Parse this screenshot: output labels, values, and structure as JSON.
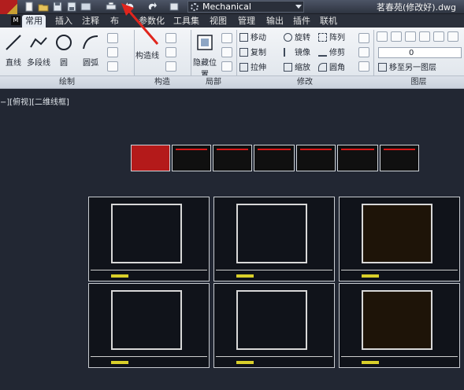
{
  "app": {
    "logo_letter": "M",
    "workspace": "Mechanical",
    "document_title": "茗春苑(修改好).dwg"
  },
  "tabs": [
    "常用",
    "插入",
    "注释",
    "布",
    "参数化",
    "工具集",
    "视图",
    "管理",
    "输出",
    "插件",
    "联机"
  ],
  "active_tab": "常用",
  "ribbon": {
    "draw": {
      "line": "直线",
      "polyline": "多段线",
      "circle": "圆",
      "arc": "圆弧",
      "footer": "绘制"
    },
    "construct": {
      "construction_line": "构造线",
      "footer": "构造"
    },
    "detail": {
      "hide": "隐藏位置",
      "footer": "局部"
    },
    "modify": {
      "move": "移动",
      "rotate": "旋转",
      "array": "阵列",
      "copy": "复制",
      "mirror": "镜像",
      "trim": "修剪",
      "stretch": "拉伸",
      "scale": "缩放",
      "fillet": "圆角",
      "footer": "修改"
    },
    "layers": {
      "layer_value": "0",
      "move_to_layer": "移至另一图层",
      "footer": "图层"
    }
  },
  "viewport_label": "−][俯视][二维线框]",
  "colors": {
    "canvas": "#222733",
    "annotation_arrow": "#e0251d",
    "drawing_red": "#d81818",
    "title_yellow": "#d9cf2a"
  },
  "icons": [
    "autocad-logo",
    "new-icon",
    "open-icon",
    "save-icon",
    "saveas-icon",
    "print-icon",
    "undo-icon",
    "redo-icon",
    "workspace-gear-icon"
  ]
}
